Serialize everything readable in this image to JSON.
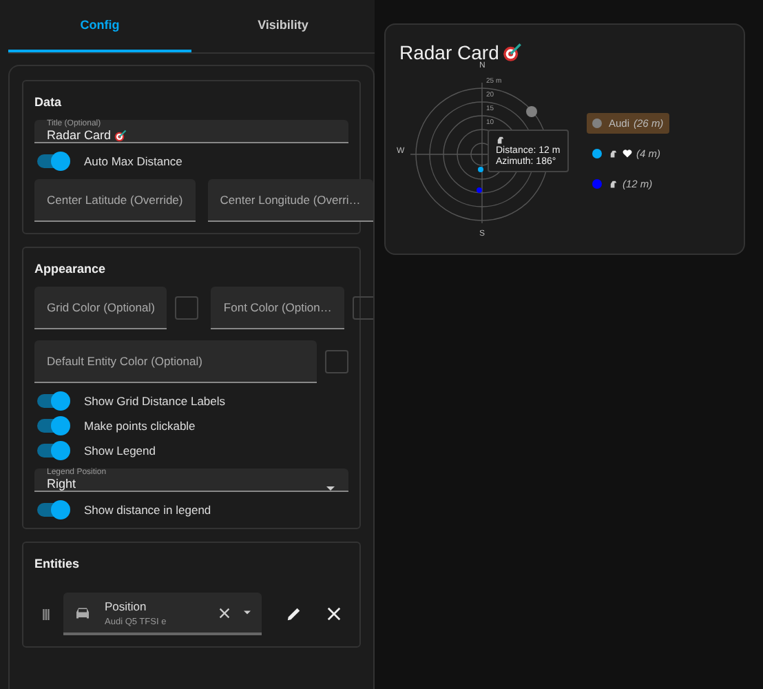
{
  "tabs": [
    {
      "label": "Config",
      "selected": true
    },
    {
      "label": "Visibility",
      "selected": false
    }
  ],
  "sections": [
    {
      "title": "Data",
      "items": [
        {
          "kind": "text",
          "label": "Title (Optional)",
          "value": "Radar Card"
        },
        {
          "kind": "toggle",
          "label": "Auto Max Distance",
          "on": true
        },
        {
          "kind": "pair",
          "fields": [
            {
              "placeholder": "Center Latitude (Override)",
              "kind": "text"
            },
            {
              "placeholder": "Center Longitude (Overri…",
              "kind": "text"
            }
          ]
        }
      ]
    },
    {
      "title": "Appearance",
      "items": [
        {
          "kind": "pair",
          "fields": [
            {
              "placeholder": "Grid Color (Optional)",
              "kind": "color"
            },
            {
              "placeholder": "Font Color (Option…",
              "kind": "color"
            }
          ]
        },
        {
          "kind": "pair",
          "fields": [
            {
              "placeholder": "Default Entity Color (Optional)",
              "kind": "color"
            }
          ]
        },
        {
          "kind": "toggle",
          "label": "Show Grid Distance Labels",
          "on": true
        },
        {
          "kind": "toggle",
          "label": "Make points clickable",
          "on": true
        },
        {
          "kind": "toggle",
          "label": "Show Legend",
          "on": true
        },
        {
          "kind": "select",
          "label": "Legend Position",
          "value": "Right"
        },
        {
          "kind": "toggle",
          "label": "Show distance in legend",
          "on": true
        }
      ]
    },
    {
      "title": "Entities",
      "items": [
        {
          "kind": "entity",
          "label": "Position",
          "value": "Audi Q5 TFSI e"
        }
      ]
    }
  ],
  "card": {
    "title": "Radar Card",
    "radar": {
      "directions": [
        "N",
        "W",
        "S"
      ],
      "ring_labels": [
        "25 m",
        "20",
        "15",
        "10"
      ],
      "points": [
        {
          "color": "#808080"
        },
        {
          "color": "#03a9f4"
        },
        {
          "color": "#0000ff"
        }
      ],
      "tooltip": {
        "lines": [
          "Distance: 12 m",
          "Azimuth: 186°"
        ]
      }
    },
    "legend": [
      {
        "label": "Audi",
        "distance": "(26 m)",
        "color": "#808080",
        "highlighted": true
      },
      {
        "distance": "(4 m)",
        "color": "#03a9f4",
        "highlighted": false
      },
      {
        "distance": "(12 m)",
        "color": "#0000ff",
        "highlighted": false
      }
    ]
  }
}
